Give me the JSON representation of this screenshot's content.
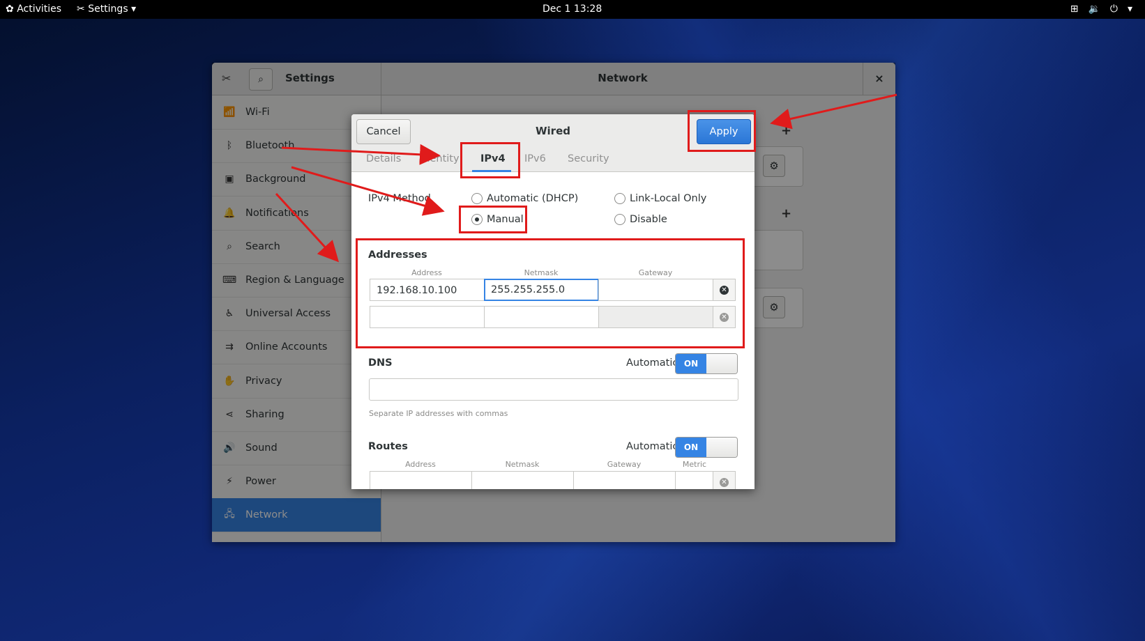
{
  "topbar": {
    "activities": "Activities",
    "app_menu": "Settings",
    "clock": "Dec 1  13:28",
    "status_icons": [
      "network-wired-icon",
      "volume-icon",
      "power-icon"
    ]
  },
  "settings_window": {
    "sidebar_title": "Settings",
    "panel_title": "Network",
    "close_symbol": "×",
    "sidebar": [
      {
        "label": "Wi-Fi",
        "icon": "wifi-icon",
        "glyph": "📶"
      },
      {
        "label": "Bluetooth",
        "icon": "bluetooth-icon",
        "glyph": "ᛒ"
      },
      {
        "label": "Background",
        "icon": "background-icon",
        "glyph": "▣"
      },
      {
        "label": "Notifications",
        "icon": "bell-icon",
        "glyph": "🔔"
      },
      {
        "label": "Search",
        "icon": "search-icon",
        "glyph": "⌕"
      },
      {
        "label": "Region & Language",
        "icon": "region-icon",
        "glyph": "⌨"
      },
      {
        "label": "Universal Access",
        "icon": "accessibility-icon",
        "glyph": "♿"
      },
      {
        "label": "Online Accounts",
        "icon": "online-accounts-icon",
        "glyph": "⇉"
      },
      {
        "label": "Privacy",
        "icon": "privacy-icon",
        "glyph": "✋"
      },
      {
        "label": "Sharing",
        "icon": "share-icon",
        "glyph": "⋖"
      },
      {
        "label": "Sound",
        "icon": "sound-icon",
        "glyph": "🔊"
      },
      {
        "label": "Power",
        "icon": "power-icon",
        "glyph": "⚡"
      },
      {
        "label": "Network",
        "icon": "network-icon",
        "glyph": "🖧",
        "active": true
      }
    ]
  },
  "dialog": {
    "title": "Wired",
    "cancel": "Cancel",
    "apply": "Apply",
    "tabs": [
      "Details",
      "Identity",
      "IPv4",
      "IPv6",
      "Security"
    ],
    "active_tab": "IPv4",
    "ipv4_method_label": "IPv4 Method",
    "methods": [
      {
        "label": "Automatic (DHCP)",
        "selected": false
      },
      {
        "label": "Link-Local Only",
        "selected": false
      },
      {
        "label": "Manual",
        "selected": true
      },
      {
        "label": "Disable",
        "selected": false
      }
    ],
    "addresses": {
      "title": "Addresses",
      "columns": [
        "Address",
        "Netmask",
        "Gateway"
      ],
      "rows": [
        {
          "address": "192.168.10.100",
          "netmask": "255.255.255.0",
          "gateway": ""
        },
        {
          "address": "",
          "netmask": "",
          "gateway": ""
        }
      ]
    },
    "dns": {
      "title": "DNS",
      "automatic_label": "Automatic",
      "switch": "ON",
      "value": "",
      "hint": "Separate IP addresses with commas"
    },
    "routes": {
      "title": "Routes",
      "automatic_label": "Automatic",
      "switch": "ON",
      "columns": [
        "Address",
        "Netmask",
        "Gateway",
        "Metric"
      ]
    }
  },
  "colors": {
    "accent": "#3584e4",
    "annotation": "#e01b1b"
  }
}
